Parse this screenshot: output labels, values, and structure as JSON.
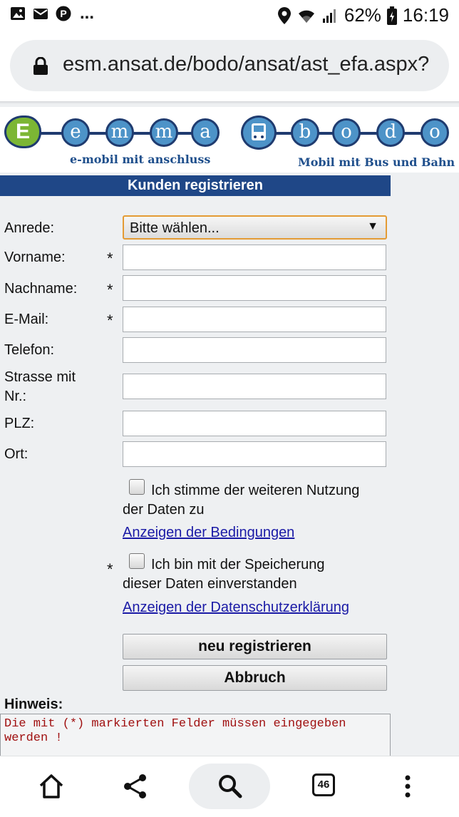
{
  "status_bar": {
    "battery": "62%",
    "time": "16:19",
    "overflow": "...",
    "left_icons": [
      "image-icon",
      "mail-icon",
      "parking-icon"
    ],
    "right_icons": [
      "location-icon",
      "wifi-icon",
      "signal-icon",
      "battery-icon"
    ]
  },
  "browser": {
    "url": "esm.ansat.de/bodo/ansat/ast_efa.aspx?"
  },
  "logos": {
    "emma": {
      "letters": [
        "E",
        "e",
        "m",
        "m",
        "a"
      ],
      "tagline": "e-mobil mit anschluss"
    },
    "bodo": {
      "letters": [
        "b",
        "o",
        "d",
        "o"
      ],
      "tagline": "Mobil mit Bus und Bahn"
    }
  },
  "form": {
    "header": "Kunden registrieren",
    "fields": {
      "anrede": {
        "label": "Anrede:",
        "value": "Bitte wählen..."
      },
      "vorname": {
        "label": "Vorname:",
        "required": "*",
        "value": ""
      },
      "nachname": {
        "label": "Nachname:",
        "required": "*",
        "value": ""
      },
      "email": {
        "label": "E-Mail:",
        "required": "*",
        "value": ""
      },
      "telefon": {
        "label": "Telefon:",
        "value": ""
      },
      "strasse": {
        "label_line1": "Strasse mit",
        "label_line2": "Nr.:",
        "value": ""
      },
      "plz": {
        "label": "PLZ:",
        "value": ""
      },
      "ort": {
        "label": "Ort:",
        "value": ""
      }
    },
    "consent_usage": {
      "text_line1": "Ich stimme der weiteren Nutzung",
      "text_line2": "der Daten zu",
      "checked": false,
      "link": "Anzeigen der Bedingungen"
    },
    "consent_storage": {
      "required": "*",
      "text_line1": "Ich bin mit der Speicherung",
      "text_line2": "dieser Daten einverstanden",
      "checked": false,
      "link": "Anzeigen der Datenschutzerklärung"
    },
    "buttons": {
      "register": "neu registrieren",
      "cancel": "Abbruch"
    },
    "hint": {
      "label": "Hinweis:",
      "text": "Die mit (*) markierten Felder müssen eingegeben werden !"
    }
  },
  "bottom_nav": {
    "tab_count": "46",
    "icons": [
      "home-icon",
      "share-icon",
      "search-icon",
      "tabs-icon",
      "more-icon"
    ]
  },
  "colors": {
    "header_bg": "#1f4787",
    "link": "#1a1aa6",
    "hint_text": "#a01010",
    "select_border": "#e49b34"
  }
}
